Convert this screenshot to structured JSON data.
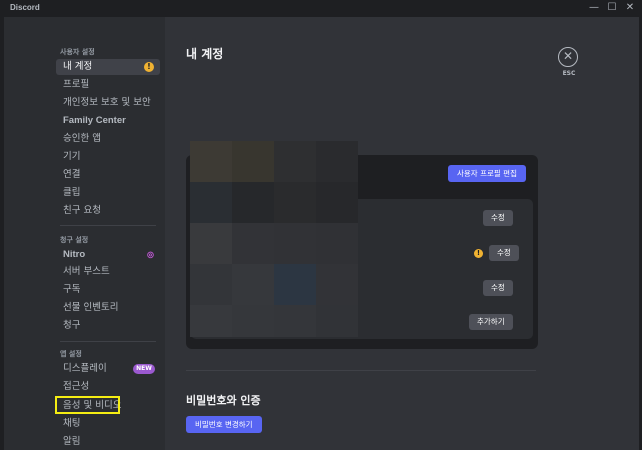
{
  "window": {
    "title": "Discord",
    "minimize_glyph": "—",
    "maximize_glyph": "☐",
    "close_glyph": "✕"
  },
  "sidebar": {
    "user_settings_header": "사용자 설정",
    "user_items": [
      {
        "label": "내 계정",
        "active": true
      },
      {
        "label": "프로필"
      },
      {
        "label": "개인정보 보호 및 보안"
      },
      {
        "label": "Family Center"
      },
      {
        "label": "승인한 앱"
      },
      {
        "label": "기기"
      },
      {
        "label": "연결"
      },
      {
        "label": "클립"
      },
      {
        "label": "친구 요청"
      }
    ],
    "billing_header": "청구 설정",
    "billing_items": [
      {
        "label": "Nitro"
      },
      {
        "label": "서버 부스트"
      },
      {
        "label": "구독"
      },
      {
        "label": "선물 인벤토리"
      },
      {
        "label": "청구"
      }
    ],
    "app_header": "앱 설정",
    "app_items": [
      {
        "label": "디스플레이",
        "badge": "NEW"
      },
      {
        "label": "접근성"
      },
      {
        "label": "음성 및 비디오",
        "highlighted": true
      },
      {
        "label": "채팅"
      },
      {
        "label": "알림"
      }
    ],
    "warning_glyph": "!",
    "nitro_icon": "◎"
  },
  "main": {
    "title": "내 계정",
    "close_glyph": "✕",
    "esc_label": "ESC",
    "edit_profile_button": "사용자 프로필 편집",
    "rows": [
      {
        "button": "수정",
        "warning": false
      },
      {
        "button": "수정",
        "warning": true
      },
      {
        "button": "수정",
        "warning": false
      },
      {
        "button": "추가하기",
        "warning": false
      }
    ],
    "row_warning_glyph": "!",
    "password_section_title": "비밀번호와 인증",
    "change_password_button": "비밀번호 변경하기"
  },
  "colors": {
    "background": "#1e1f22",
    "sidebar": "#2b2d31",
    "content": "#313338",
    "accent": "#5865f2",
    "warning": "#f0b232",
    "highlight_box": "#f5ed13",
    "new_badge": "#9b59d0"
  }
}
